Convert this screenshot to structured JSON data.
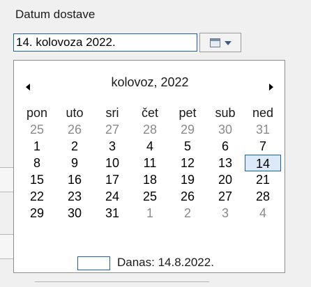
{
  "field": {
    "label": "Datum dostave",
    "value": "14. kolovoza 2022."
  },
  "dropdown": {
    "icon": "calendar-dropdown-icon"
  },
  "calendar": {
    "month_title": "kolovoz, 2022",
    "weekdays": [
      "pon",
      "uto",
      "sri",
      "čet",
      "pet",
      "sub",
      "ned"
    ],
    "weeks": [
      [
        {
          "d": "25",
          "m": true
        },
        {
          "d": "26",
          "m": true
        },
        {
          "d": "27",
          "m": true
        },
        {
          "d": "28",
          "m": true
        },
        {
          "d": "29",
          "m": true
        },
        {
          "d": "30",
          "m": true
        },
        {
          "d": "31",
          "m": true
        }
      ],
      [
        {
          "d": "1"
        },
        {
          "d": "2"
        },
        {
          "d": "3"
        },
        {
          "d": "4"
        },
        {
          "d": "5"
        },
        {
          "d": "6"
        },
        {
          "d": "7"
        }
      ],
      [
        {
          "d": "8"
        },
        {
          "d": "9"
        },
        {
          "d": "10"
        },
        {
          "d": "11"
        },
        {
          "d": "12"
        },
        {
          "d": "13"
        },
        {
          "d": "14",
          "today": true
        }
      ],
      [
        {
          "d": "15"
        },
        {
          "d": "16"
        },
        {
          "d": "17"
        },
        {
          "d": "18"
        },
        {
          "d": "19"
        },
        {
          "d": "20"
        },
        {
          "d": "21"
        }
      ],
      [
        {
          "d": "22"
        },
        {
          "d": "23"
        },
        {
          "d": "24"
        },
        {
          "d": "25"
        },
        {
          "d": "26"
        },
        {
          "d": "27"
        },
        {
          "d": "28"
        }
      ],
      [
        {
          "d": "29"
        },
        {
          "d": "30"
        },
        {
          "d": "31"
        },
        {
          "d": "1",
          "m": true
        },
        {
          "d": "2",
          "m": true
        },
        {
          "d": "3",
          "m": true
        },
        {
          "d": "4",
          "m": true
        }
      ]
    ],
    "today_text": "Danas: 14.8.2022."
  },
  "colors": {
    "accent": "#1b5fae",
    "muted_day": "#8a8a8a",
    "today_bg": "#dce9f8"
  }
}
